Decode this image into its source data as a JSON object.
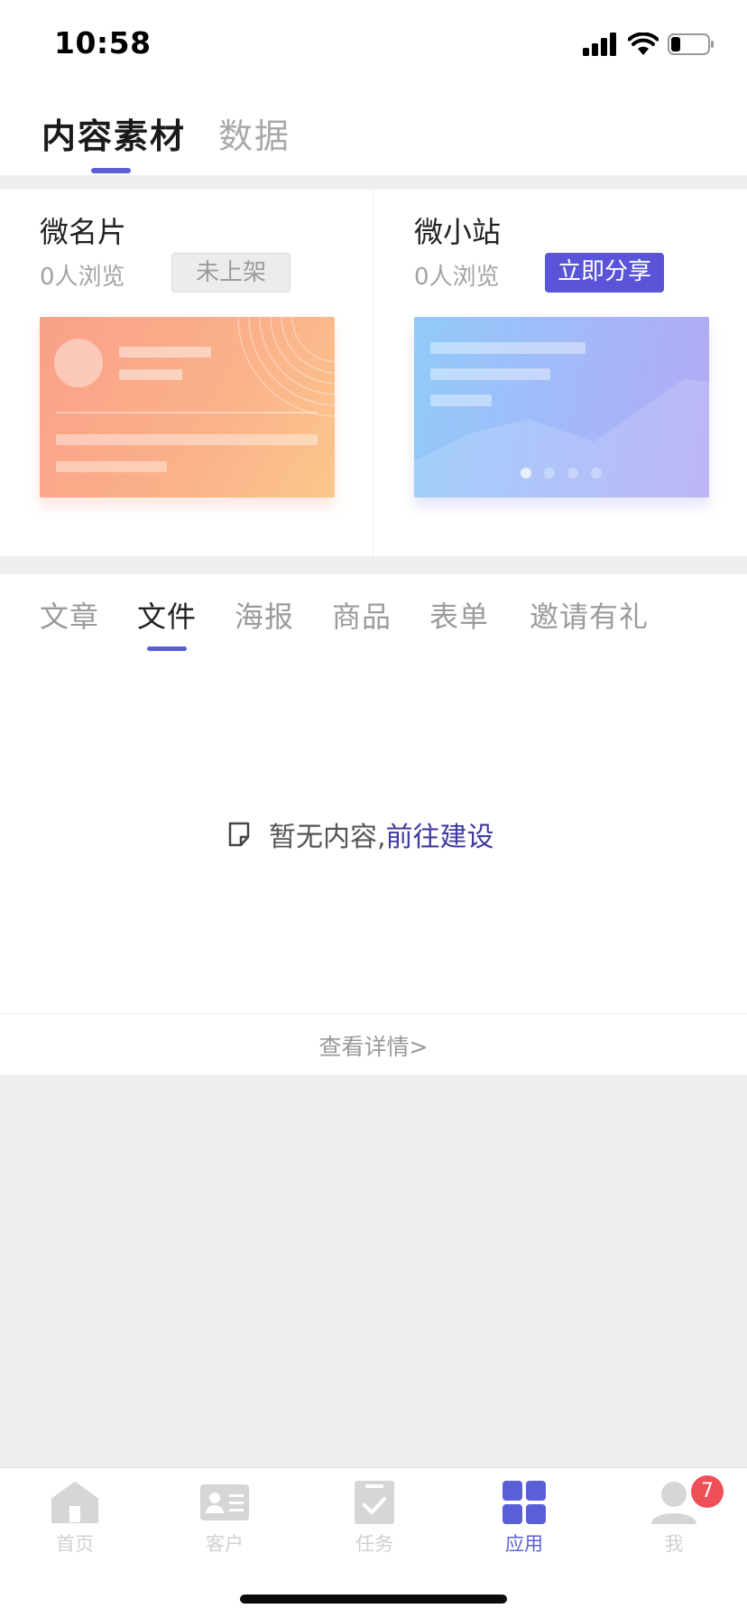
{
  "status_bar": {
    "time": "10:58"
  },
  "top_tabs": {
    "active": "内容素材",
    "inactive": "数据"
  },
  "cards": {
    "left": {
      "title": "微名片",
      "views": "0人浏览",
      "button": "未上架"
    },
    "right": {
      "title": "微小站",
      "views": "0人浏览",
      "button": "立即分享"
    }
  },
  "content_tabs": [
    "文章",
    "文件",
    "海报",
    "商品",
    "表单",
    "邀请有礼"
  ],
  "empty_state": {
    "text": "暂无内容,",
    "link": "前往建设"
  },
  "detail_link": "查看详情>",
  "bottom_nav": {
    "items": [
      {
        "label": "首页",
        "icon": "home-icon"
      },
      {
        "label": "客户",
        "icon": "contact-card-icon"
      },
      {
        "label": "任务",
        "icon": "task-check-icon"
      },
      {
        "label": "应用",
        "icon": "apps-grid-icon"
      },
      {
        "label": "我",
        "icon": "user-icon"
      }
    ],
    "active_index": 3,
    "badge": "7"
  },
  "colors": {
    "accent": "#5a5fd8",
    "badge": "#ef4f57"
  }
}
